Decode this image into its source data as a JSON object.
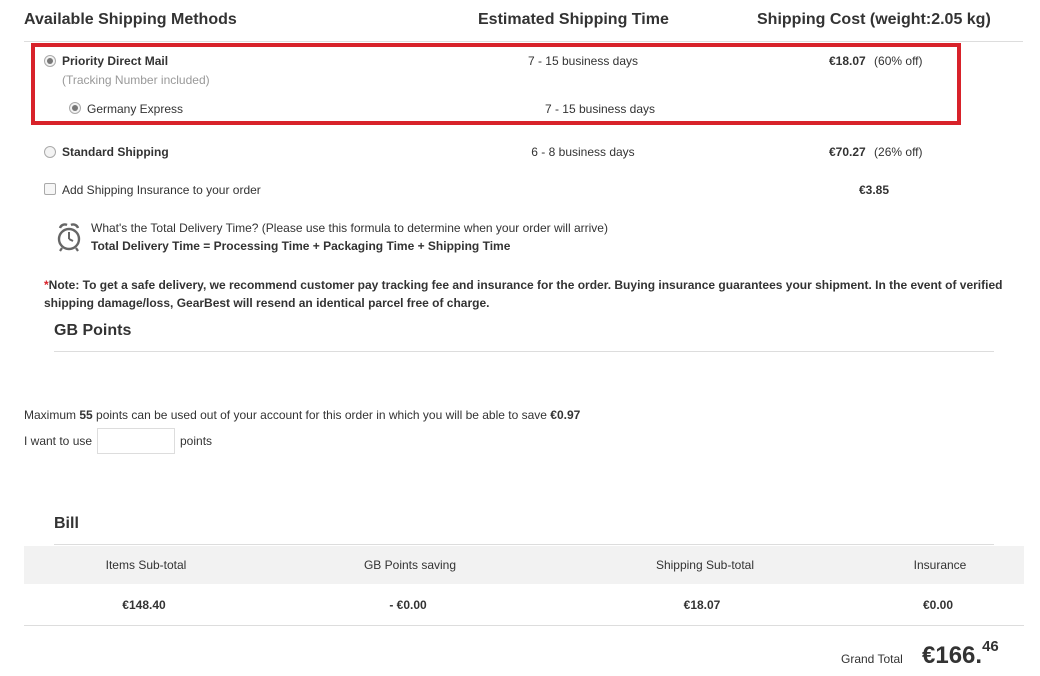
{
  "shipping": {
    "headers": {
      "methods": "Available Shipping Methods",
      "time": "Estimated Shipping Time",
      "cost": "Shipping Cost (weight:2.05 kg)"
    },
    "options": [
      {
        "name": "Priority Direct Mail",
        "sub": "(Tracking Number included)",
        "time": "7 - 15 business days",
        "price": "€18.07",
        "discount": "(60% off)",
        "selected": true,
        "suboption": {
          "name": "Germany Express",
          "time": "7 - 15 business days",
          "selected": true
        }
      },
      {
        "name": "Standard Shipping",
        "time": "6 - 8 business days",
        "price": "€70.27",
        "discount": "(26% off)",
        "selected": false
      }
    ],
    "insurance": {
      "label": "Add Shipping Insurance to your order",
      "price": "€3.85",
      "checked": false
    },
    "delivery_info": {
      "question": "What's the Total Delivery Time? (Please use this formula to determine when your order will arrive)",
      "formula": "Total Delivery Time = Processing Time + Packaging Time + Shipping Time"
    },
    "note": {
      "star": "*",
      "text": "Note: To get a safe delivery, we recommend customer pay tracking fee and insurance for the order. Buying insurance guarantees your shipment. In the event of verified shipping damage/loss, GearBest will resend an identical parcel free of charge."
    },
    "highlight_color": "#d8222a"
  },
  "points": {
    "title": "GB Points",
    "max_pre": "Maximum ",
    "max_points": "55",
    "max_mid": " points can be used out of your account for this order in which you will be able to save ",
    "max_save": "€0.97",
    "use_label": "I want to use",
    "use_value": "",
    "use_suffix": "points"
  },
  "bill": {
    "title": "Bill",
    "columns": [
      "Items Sub-total",
      "GB Points saving",
      "Shipping Sub-total",
      "Insurance"
    ],
    "values": [
      "€148.40",
      "- €0.00",
      "€18.07",
      "€0.00"
    ],
    "grand_label": "Grand Total",
    "grand_main": "€166.",
    "grand_cents": "46"
  }
}
